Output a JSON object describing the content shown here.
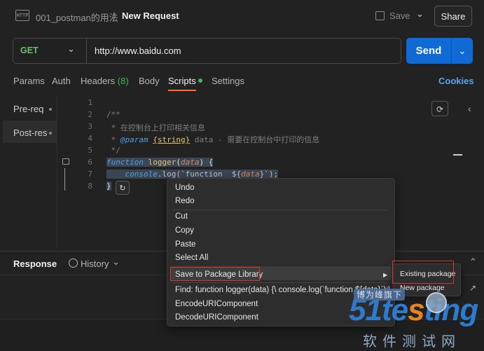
{
  "header": {
    "collection_icon": "HTTP",
    "collection": "001_postman的用法",
    "separator": "/",
    "request_name": "New Request",
    "save_label": "Save",
    "share_label": "Share"
  },
  "request": {
    "method": "GET",
    "url": "http://www.baidu.com",
    "send_label": "Send"
  },
  "tabs": [
    {
      "label": "Params"
    },
    {
      "label": "Auth"
    },
    {
      "label": "Headers",
      "count": "(8)"
    },
    {
      "label": "Body"
    },
    {
      "label": "Scripts",
      "active": true
    },
    {
      "label": "Settings"
    }
  ],
  "cookies_label": "Cookies",
  "scripts_sidebar": [
    {
      "label": "Pre-req"
    },
    {
      "label": "Post-res",
      "active": true
    }
  ],
  "editor": {
    "line_numbers": [
      "1",
      "2",
      "3",
      "4",
      "5",
      "6",
      "7",
      "8"
    ],
    "comment_open": "/**",
    "comment_line1": " * 在控制台上打印相关信息",
    "comment_line2_tag": "@param",
    "comment_line2_type": "{string}",
    "comment_line2_rest": " data - 需要在控制台中打印的信息",
    "comment_close": " */",
    "kw_function": "function",
    "fn_name": " logger",
    "param_open": "(",
    "param": "data",
    "param_close": ") {",
    "indent": "    ",
    "console": "console",
    "log_call": ".log(`function  ${",
    "log_var": "data",
    "log_end": "}`);",
    "close_brace": "}"
  },
  "response": {
    "label": "Response",
    "history_label": "History"
  },
  "context_menu": {
    "items": [
      {
        "label": "Undo"
      },
      {
        "label": "Redo"
      },
      {
        "label": "Cut"
      },
      {
        "label": "Copy"
      },
      {
        "label": "Paste"
      },
      {
        "label": "Select All"
      },
      {
        "label": "Save to Package Library",
        "submenu": true
      },
      {
        "label": "Find: function logger(data) {\\     console.log(`function  ${data}`);\\"
      },
      {
        "label": "EncodeURIComponent"
      },
      {
        "label": "DecodeURIComponent"
      }
    ],
    "submenu": [
      "Existing package",
      "New package"
    ]
  },
  "watermark": {
    "top_text": "博为峰旗下",
    "logo_a": "51te",
    "logo_b": "s",
    "logo_c": "ting",
    "cn_text": "软件测试网"
  },
  "colors": {
    "accent_orange": "#ff6c37",
    "send_blue": "#0f6ad6",
    "get_green": "#6bbe6b",
    "highlight_red": "#e03030"
  }
}
